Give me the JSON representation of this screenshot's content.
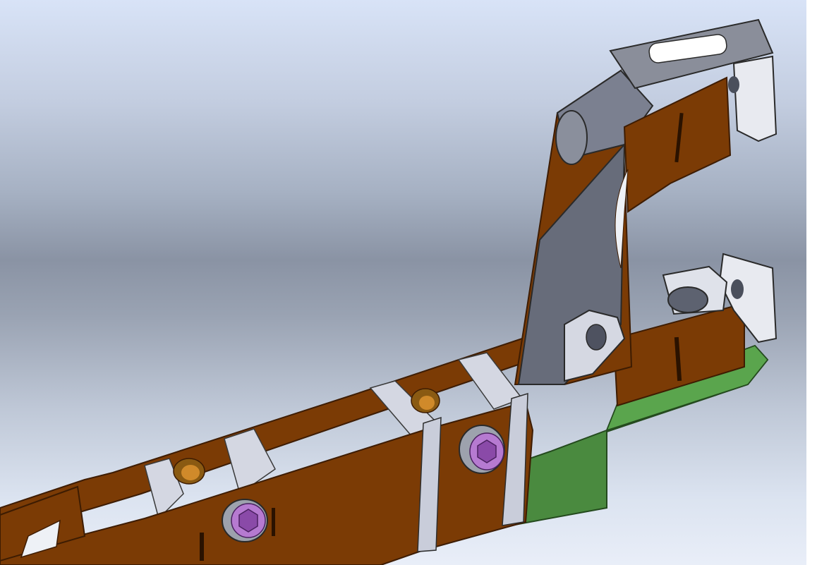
{
  "viewport": {
    "kind": "3d-cad-model",
    "background": {
      "top": "#d8e3f7",
      "middle": "#8a93a4",
      "bottom": "#e9eef8"
    }
  },
  "colors": {
    "sheet_metal": "#7b3b05",
    "sheet_metal_edge": "#5a2a02",
    "steel_grey": "#676c7a",
    "light_plate": "#c9cdda",
    "base_plate": "#4a8a3f",
    "bolt_head": "#b67ad1",
    "bushing": "#d08a2a"
  },
  "model": {
    "icons": {
      "bolt_1": "hex-socket-bolt-icon",
      "bolt_2": "hex-socket-bolt-icon",
      "bushing_1": "bushing-icon",
      "bushing_2": "bushing-icon"
    }
  }
}
